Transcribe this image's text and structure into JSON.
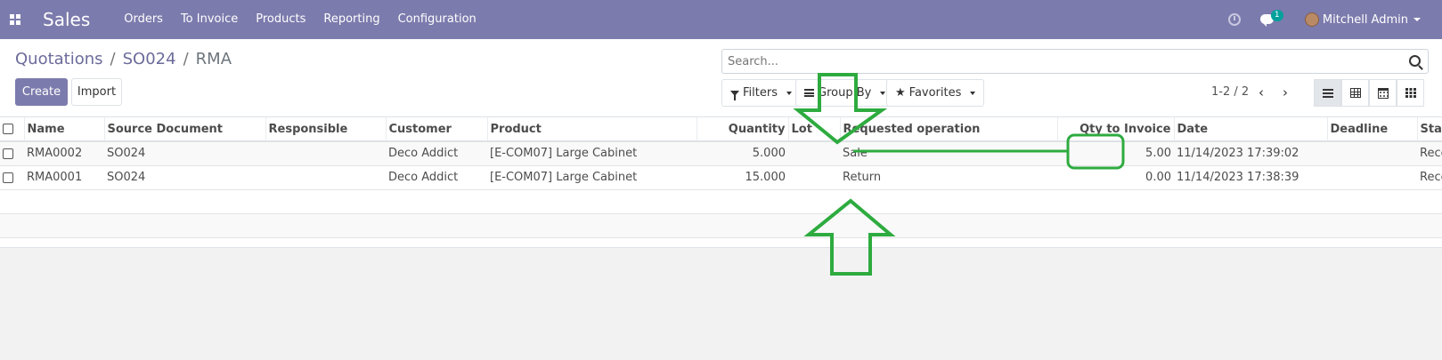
{
  "navbar": {
    "app_name": "Sales",
    "menu": [
      "Orders",
      "To Invoice",
      "Products",
      "Reporting",
      "Configuration"
    ],
    "chat_count": "1",
    "user_name": "Mitchell Admin"
  },
  "breadcrumb": {
    "items": [
      "Quotations",
      "SO024",
      "RMA"
    ],
    "separator": "/"
  },
  "buttons": {
    "create": "Create",
    "import": "Import"
  },
  "search": {
    "placeholder": "Search..."
  },
  "filters": {
    "filters_label": "Filters",
    "group_by_label": "Group By",
    "favorites_label": "Favorites"
  },
  "pager": {
    "value": "1-2 / 2"
  },
  "table": {
    "columns": [
      "Name",
      "Source Document",
      "Responsible",
      "Customer",
      "Product",
      "Quantity",
      "Lot",
      "Requested operation",
      "Qty to Invoice",
      "Date",
      "Deadline",
      "State"
    ],
    "rows": [
      {
        "name": "RMA0002",
        "source": "SO024",
        "responsible": "",
        "customer": "Deco Addict",
        "product": "[E-COM07] Large Cabinet",
        "quantity": "5.000",
        "lot": "",
        "operation": "Sale",
        "qty_invoice": "5.00",
        "date": "11/14/2023 17:39:02",
        "deadline": "",
        "state": "Received"
      },
      {
        "name": "RMA0001",
        "source": "SO024",
        "responsible": "",
        "customer": "Deco Addict",
        "product": "[E-COM07] Large Cabinet",
        "quantity": "15.000",
        "lot": "",
        "operation": "Return",
        "qty_invoice": "0.00",
        "date": "11/14/2023 17:38:39",
        "deadline": "",
        "state": "Received"
      }
    ]
  },
  "colors": {
    "navbar": "#7c7bad",
    "primary": "#7c7bad",
    "annotation": "#2eab3f",
    "badge": "#00a09d"
  }
}
